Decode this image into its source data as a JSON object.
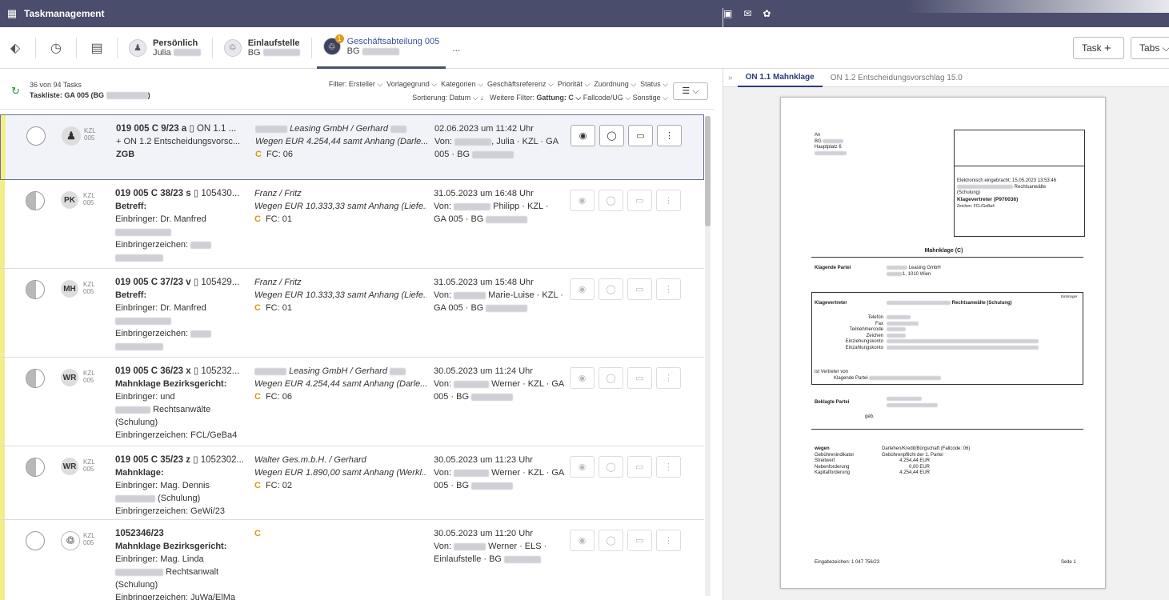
{
  "app": {
    "title": "Taskmanagement"
  },
  "toolbar": {
    "contexts": [
      {
        "line1": "Persönlich",
        "line2": "Julia"
      },
      {
        "line1": "Einlaufstelle",
        "line2": "BG"
      },
      {
        "line1": "Geschäftsabteilung 005",
        "line2": "BG",
        "badge": "1"
      }
    ],
    "more": "...",
    "task_button": "Task",
    "task_plus": "+",
    "tabs_button": "Tabs"
  },
  "list": {
    "count": "36 von 94 Tasks",
    "tasklist": "Taskliste: GA 005 (BG",
    "tasklist_end": ")",
    "filter_label": "Filter:",
    "filters": [
      "Ersteller",
      "Vorlagegrund",
      "Kategorien",
      "Geschäftsreferenz",
      "Priorität",
      "Zuordnung",
      "Status"
    ],
    "sort_label": "Sortierung:",
    "sort_value": "Datum",
    "sort_dir": "↓",
    "more_filter_label": "Weitere Filter:",
    "more_filter_value": "Gattung: C",
    "extra_filters": [
      "Fallcode/UG",
      "Sonstige"
    ],
    "rows": [
      {
        "who": "♟",
        "kzl1": "KZL",
        "kzl2": "005",
        "id": "019 005 C 9/23 a ",
        "doc": "ON 1.1 ...",
        "l2": "+ ON 1.2 Entscheidungsvorsc...",
        "l3": "ZGB",
        "l4": "",
        "l5": "",
        "l6": "",
        "parties": "Leasing GmbH / Gerhard",
        "subject": "Wegen EUR 4.254,44 samt Anhang (Darle...",
        "gattung": "C",
        "fc": "FC: 06",
        "date": "02.06.2023 um 11:42 Uhr",
        "from": "Von:",
        "from2": ", Julia · KZL · GA",
        "from3": "005 · BG"
      },
      {
        "who": "PK",
        "kzl1": "KZL",
        "kzl2": "005",
        "id": "019 005 C 38/23 s ",
        "doc": "105430...",
        "l2": "Betreff:",
        "l3": "Einbringer: Dr. Manfred",
        "l4": "",
        "l5": "Einbringerzeichen:",
        "l6": "",
        "parties": "Franz / Fritz",
        "subject": "Wegen EUR 10.333,33 samt Anhang (Liefe...",
        "gattung": "C",
        "fc": "FC: 01",
        "date": "31.05.2023 um 16:48 Uhr",
        "from": "Von:",
        "from2": "Philipp · KZL ·",
        "from3": "GA 005 · BG"
      },
      {
        "who": "MH",
        "kzl1": "KZL",
        "kzl2": "005",
        "id": "019 005 C 37/23 v ",
        "doc": "105429...",
        "l2": "Betreff:",
        "l3": "Einbringer: Dr. Manfred",
        "l4": "",
        "l5": "Einbringerzeichen:",
        "l6": "",
        "parties": "Franz / Fritz",
        "subject": "Wegen EUR 10.333,33 samt Anhang (Liefe...",
        "gattung": "C",
        "fc": "FC: 01",
        "date": "31.05.2023 um 15:48 Uhr",
        "from": "Von:",
        "from2": "Marie-Luise · KZL ·",
        "from3": "GA 005 · BG"
      },
      {
        "who": "WR",
        "kzl1": "KZL",
        "kzl2": "005",
        "id": "019 005 C 36/23 x ",
        "doc": "105232...",
        "l2": "Mahnklage Bezirksgericht:",
        "l3": "Einbringer: und",
        "l4": "Rechtsanwälte",
        "l5": "(Schulung)",
        "l6": "Einbringerzeichen: FCL/GeBa4",
        "parties": "Leasing GmbH / Gerhard",
        "subject": "Wegen EUR 4.254,44 samt Anhang (Darle...",
        "gattung": "C",
        "fc": "FC: 06",
        "date": "30.05.2023 um 11:24 Uhr",
        "from": "Von:",
        "from2": "Werner · KZL · GA",
        "from3": "005 · BG"
      },
      {
        "who": "WR",
        "kzl1": "KZL",
        "kzl2": "005",
        "id": "019 005 C 35/23 z ",
        "doc": "1052302...",
        "l2": "Mahnklage:",
        "l3": "Einbringer: Mag. Dennis",
        "l4": "(Schulung)",
        "l5": "Einbringerzeichen: GeWi/23",
        "l6": "",
        "parties": "Walter Ges.m.b.H. / Gerhard",
        "subject": "Wegen EUR 1.890,00 samt Anhang (Werkl...",
        "gattung": "C",
        "fc": "FC: 02",
        "date": "30.05.2023 um 11:23 Uhr",
        "from": "Von:",
        "from2": "Werner · KZL · GA",
        "from3": "005 · BG"
      },
      {
        "who": "♲",
        "kzl1": "KZL",
        "kzl2": "005",
        "id": "1052346/23",
        "doc": "",
        "l2": "Mahnklage Bezirksgericht:",
        "l3": "Einbringer: Mag. Linda",
        "l4": "Rechtsanwalt",
        "l5": "(Schulung)",
        "l6": "Einbringerzeichen: JuWa/ElMa",
        "parties": "",
        "subject": "",
        "gattung": "C",
        "fc": "",
        "date": "30.05.2023 um 11:20 Uhr",
        "from": "Von:",
        "from2": "Werner · ELS ·",
        "from3": "Einlaufstelle · BG"
      }
    ]
  },
  "preview": {
    "collapse": "»",
    "tabs": [
      "ON 1.1 Mahnklage",
      "ON 1.2 Entscheidungsvorschlag 15.0"
    ],
    "doc": {
      "an": "An",
      "bg": "BG",
      "addr": "Hauptplatz 6",
      "eingebracht": "Elektronisch eingebracht: 15.05.2023 13:53:46",
      "ra": "Rechtsanwälte",
      "schulung": "(Schulung)",
      "klv": "Klagevertreter (P970036)",
      "zeichen": "Zeichen: FCL/GeBa4",
      "heading": "Mahnklage (C)",
      "klagende_label": "Klagende Partei",
      "klagende_name": "Leasing GmbH",
      "klagende_addr": "1, 1010 Wien",
      "einbringer": "Einbringer",
      "kv_label": "Klagevertreter",
      "kv_name": "Rechtsanwälte (Schulung)",
      "kv_fields": [
        "Telefon",
        "Fax",
        "Teilnehmercode",
        "Zeichen",
        "Einziehungskonto",
        "Einzahlungskonto"
      ],
      "vertreter": "ist Vertreter von",
      "vertreter2": "Klagende Partei",
      "beklagte": "Beklagte Partei",
      "geb": "geb.",
      "wegen": "wegen",
      "wegen_val": "Darlehen/Kredit/Bürgschaft (Fallcode: 06)",
      "gi": "Gebührenindikator",
      "gi_val": "Gebührenpflicht der 1. Partei",
      "sw": "Streitwert",
      "sw_val": "4.254,44 EUR",
      "nf": "Nebenforderung",
      "nf_val": "0,00 EUR",
      "kf": "Kapitalforderung",
      "kf_val": "4.254,44 EUR",
      "footer_left": "Eingabezeichen: 1 047 756/23",
      "footer_right": "Seite 1"
    }
  }
}
